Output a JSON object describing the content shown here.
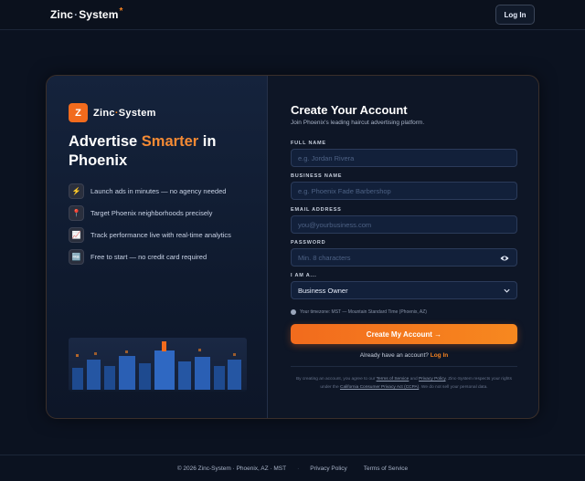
{
  "header": {
    "brand_name": "Zinc",
    "brand_sep": "·",
    "brand_suffix": "System",
    "brand_mark": "*",
    "login_label": "Log In"
  },
  "left_panel": {
    "logo_letter": "Z",
    "brand_name": "Zinc",
    "brand_sep": "·",
    "brand_suffix": "System",
    "headline_pre": "Advertise ",
    "headline_accent": "Smarter",
    "headline_post": " in Phoenix",
    "features": [
      {
        "icon": "lightning-icon",
        "glyph": "⚡",
        "text": "Launch ads in minutes — no agency needed"
      },
      {
        "icon": "pin-icon",
        "glyph": "📍",
        "text": "Target Phoenix neighborhoods precisely"
      },
      {
        "icon": "chart-icon",
        "glyph": "📈",
        "text": "Track performance live with real-time analytics"
      },
      {
        "icon": "free-icon",
        "glyph": "🆓",
        "text": "Free to start — no credit card required"
      }
    ]
  },
  "form": {
    "title": "Create Your Account",
    "subtitle": "Join Phoenix's leading haircut advertising platform.",
    "full_name_label": "FULL NAME",
    "full_name_placeholder": "e.g. Jordan Rivera",
    "business_name_label": "BUSINESS NAME",
    "business_name_placeholder": "e.g. Phoenix Fade Barbershop",
    "email_label": "EMAIL ADDRESS",
    "email_placeholder": "you@yourbusiness.com",
    "password_label": "PASSWORD",
    "password_placeholder": "Min. 8 characters",
    "role_label": "I AM A...",
    "role_value": "Business Owner",
    "timezone_text": "Your timezone: MST — Mountain Standard Time (Phoenix, AZ)",
    "submit_label": "Create My Account →",
    "have_account_text": "Already have an account?",
    "login_link": "Log In",
    "legal_1": "By creating an account, you agree to our",
    "terms_link": "Terms of Service",
    "legal_and": "and",
    "privacy_link": "Privacy Policy",
    "legal_2": ". Zinc-System respects your rights under the",
    "ccpa_link": "California Consumer Privacy Act (CCPA)",
    "legal_3": ". We do not sell your personal data."
  },
  "footer": {
    "copyright": "© 2026 Zinc-System · Phoenix, AZ · MST",
    "sep1": "·",
    "privacy": "Privacy Policy",
    "terms": "Terms of Service"
  },
  "colors": {
    "accent": "#f26b1d",
    "background": "#0b1220",
    "card": "#0e1626"
  }
}
